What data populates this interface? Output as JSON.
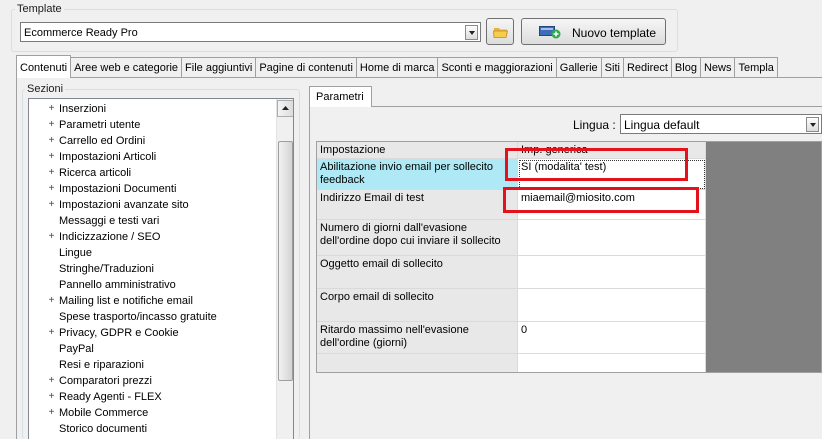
{
  "template_group": {
    "title": "Template",
    "selected": "Ecommerce Ready Pro",
    "new_button": "Nuovo template"
  },
  "tabs": [
    {
      "label": "Contenuti",
      "active": true
    },
    {
      "label": "Aree web e categorie"
    },
    {
      "label": "File aggiuntivi"
    },
    {
      "label": "Pagine di contenuti"
    },
    {
      "label": "Home di marca"
    },
    {
      "label": "Sconti e maggiorazioni"
    },
    {
      "label": "Gallerie"
    },
    {
      "label": "Siti"
    },
    {
      "label": "Redirect"
    },
    {
      "label": "Blog"
    },
    {
      "label": "News"
    },
    {
      "label": "Templa"
    }
  ],
  "sections": {
    "title": "Sezioni",
    "items": [
      {
        "label": "Inserzioni",
        "expandable": true
      },
      {
        "label": "Parametri utente",
        "expandable": true
      },
      {
        "label": "Carrello ed Ordini",
        "expandable": true
      },
      {
        "label": "Impostazioni Articoli",
        "expandable": true
      },
      {
        "label": "Ricerca articoli",
        "expandable": true
      },
      {
        "label": "Impostazioni Documenti",
        "expandable": true
      },
      {
        "label": "Impostazioni avanzate sito",
        "expandable": true
      },
      {
        "label": "Messaggi e testi vari",
        "expandable": false
      },
      {
        "label": "Indicizzazione / SEO",
        "expandable": true
      },
      {
        "label": "Lingue",
        "expandable": false
      },
      {
        "label": "Stringhe/Traduzioni",
        "expandable": false
      },
      {
        "label": "Pannello amministrativo",
        "expandable": false
      },
      {
        "label": "Mailing list e notifiche email",
        "expandable": true
      },
      {
        "label": "Spese trasporto/incasso gratuite",
        "expandable": false
      },
      {
        "label": "Privacy, GDPR e Cookie",
        "expandable": true
      },
      {
        "label": "PayPal",
        "expandable": false
      },
      {
        "label": "Resi e riparazioni",
        "expandable": false
      },
      {
        "label": "Comparatori prezzi",
        "expandable": true
      },
      {
        "label": "Ready Agenti - FLEX",
        "expandable": true
      },
      {
        "label": "Mobile Commerce",
        "expandable": true
      },
      {
        "label": "Storico documenti",
        "expandable": false
      }
    ]
  },
  "params": {
    "tab_label": "Parametri",
    "lingua_label": "Lingua :",
    "lingua_value": "Lingua default",
    "header": {
      "setting": "Impostazione",
      "value": "Imp. generica"
    },
    "rows": [
      {
        "label": "Abilitazione invio email per sollecito feedback",
        "value": "SI (modalita' test)",
        "selected": true
      },
      {
        "label": "Indirizzo Email di test",
        "value": "miaemail@miosito.com"
      },
      {
        "label": "Numero di giorni dall'evasione dell'ordine dopo cui inviare il sollecito",
        "value": ""
      },
      {
        "label": "Oggetto email di sollecito",
        "value": ""
      },
      {
        "label": "Corpo email di sollecito",
        "value": ""
      },
      {
        "label": "Ritardo massimo nell'evasione dell'ordine (giorni)",
        "value": "0"
      },
      {
        "label": "",
        "value": ""
      }
    ]
  },
  "icons": {
    "expand": "plus-expand-icon",
    "folder": "folder-open-icon",
    "new_template": "new-template-icon",
    "scroll_up": "arrow-up-icon",
    "dropdown": "chevron-down-icon"
  },
  "colors": {
    "selection": "#aee9f5",
    "highlight_box": "#e3121c",
    "grid_empty": "#808080"
  }
}
